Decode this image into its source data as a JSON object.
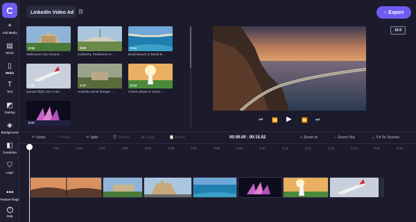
{
  "app": {
    "logo_letter": "C"
  },
  "sidebar": {
    "items": [
      {
        "label": "Add Media",
        "icon": "plus-icon",
        "glyph": "+"
      },
      {
        "label": "Stock",
        "icon": "stock-icon",
        "glyph": "▤"
      },
      {
        "label": "Media",
        "icon": "media-icon",
        "glyph": "▯"
      },
      {
        "label": "Text",
        "icon": "text-icon",
        "glyph": "T"
      },
      {
        "label": "Overlay",
        "icon": "overlay-icon",
        "glyph": "◩"
      },
      {
        "label": "Background",
        "icon": "background-icon",
        "glyph": "◈"
      },
      {
        "label": "Transition",
        "icon": "transition-icon",
        "glyph": "◧"
      },
      {
        "label": "Logo",
        "icon": "logo-shield-icon",
        "glyph": "⛉"
      },
      {
        "label": "Feature Flags",
        "icon": "more-icon",
        "glyph": "•••"
      },
      {
        "label": "Help",
        "icon": "help-icon",
        "glyph": "?"
      }
    ]
  },
  "header": {
    "project_title": "Linkedin Video Ad",
    "export_label": "Export",
    "export_glyph": "↑",
    "accent_color": "#6f5cf0"
  },
  "media": {
    "items": [
      {
        "caption": "Melbourne City Victoria ...",
        "duration": "0:16"
      },
      {
        "caption": "Canberra, Parliament H...",
        "duration": "0:03"
      },
      {
        "caption": "Bondi Beach or Bondi B...",
        "duration": "0:14"
      },
      {
        "caption": "Qantas flight over Austr...",
        "duration": "0:34"
      },
      {
        "caption": "Australia aerial footage ...",
        "duration": "0:17"
      },
      {
        "caption": "Cricket player in action ...",
        "duration": "0:13"
      },
      {
        "caption": "",
        "duration": "0:17"
      }
    ]
  },
  "preview": {
    "aspect_ratio": "16:9",
    "controls": {
      "skip_back": "⏮",
      "rewind": "⏪",
      "play": "▶",
      "forward": "⏩",
      "skip_forward": "⏭"
    }
  },
  "toolbar": {
    "undo": "Undo",
    "redo": "Redo",
    "split": "Split",
    "delete": "Delete",
    "copy": "Copy",
    "paste": "Paste",
    "time_current": "00:00.00",
    "time_separator": "|",
    "time_total": "00:15.52",
    "zoom_in": "Zoom In",
    "zoom_out": "Zoom Out",
    "fit": "Fit To Screen"
  },
  "timeline": {
    "ticks": [
      "0:01",
      "0:02",
      "0:03",
      "0:04",
      "0:05",
      "0:06",
      "0:07",
      "0:08",
      "0:09",
      "0:10",
      "0:11",
      "0:12",
      "0:13",
      "0:14",
      "0:15",
      "0:16"
    ]
  }
}
